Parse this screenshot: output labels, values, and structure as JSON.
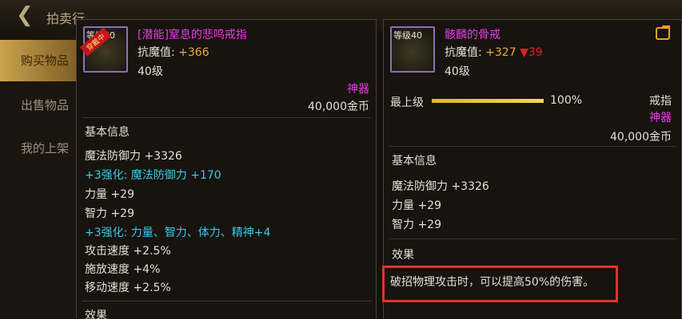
{
  "topbar": {
    "back_icon": "back-arrow-icon",
    "title": "拍卖行"
  },
  "sidebar": {
    "items": [
      {
        "label": "购买物品"
      },
      {
        "label": "出售物品"
      },
      {
        "label": "我的上架"
      }
    ]
  },
  "left_item": {
    "level_tag": "等级40",
    "badge": "穿戴中",
    "name": "[潜能]窒息的悲鸣戒指",
    "magic_resist_label": "抗魔值:",
    "magic_resist_value": "+366",
    "level": "40级",
    "rarity": "神器",
    "price": "40,000金币",
    "section_basic": "基本信息",
    "stats": [
      {
        "text": "魔法防御力 +3326"
      },
      {
        "text": "+3强化: 魔法防御力 +170"
      },
      {
        "text": "力量 +29"
      },
      {
        "text": "智力 +29"
      },
      {
        "text": "+3强化: 力量、智力、体力、精神+4"
      },
      {
        "text": "攻击速度 +2.5%"
      },
      {
        "text": "施放速度 +4%"
      },
      {
        "text": "移动速度 +2.5%"
      }
    ],
    "section_effect": "效果"
  },
  "right_item": {
    "level_tag": "等级40",
    "name": "骸麟的骨戒",
    "magic_resist_label": "抗魔值:",
    "magic_resist_value": "+327",
    "magic_resist_diff": "▼39",
    "level": "40级",
    "durability_label": "最上级",
    "durability_percent": "100%",
    "durability_fraction": 1.0,
    "type": "戒指",
    "rarity": "神器",
    "price": "40,000金币",
    "section_basic": "基本信息",
    "stats": [
      {
        "text": "魔法防御力 +3326"
      },
      {
        "text": "力量 +29"
      },
      {
        "text": "智力 +29"
      }
    ],
    "section_effect": "效果",
    "effect_text": "破招物理攻击时，可以提高50%的伤害。"
  },
  "colors": {
    "name": "#e23fe0",
    "resist_value": "#f3a640",
    "diff": "#e12020",
    "enhance": "#39c9e8",
    "highlight": "#e43329"
  }
}
